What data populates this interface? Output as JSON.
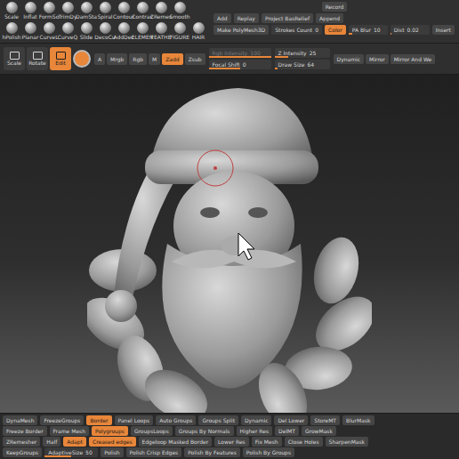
{
  "palette": {
    "rows": [
      [
        "Scale",
        "Inflat",
        "FormSo",
        "TrimDy",
        "DamSta",
        "Spiral",
        "Contour",
        "Contrac",
        "ZRemes",
        "Smooth"
      ],
      [
        "hPolish",
        "Planar",
        "CurveL",
        "CurveQ",
        "Slide",
        "DecoCu",
        "AddDec",
        "ELEMEN",
        "FEATHE",
        "FIGURE",
        "HAIR"
      ]
    ]
  },
  "stroke_panel": {
    "rows": [
      [
        {
          "kind": "button",
          "label": "Record",
          "active": false
        }
      ],
      [
        {
          "kind": "button",
          "label": "Add",
          "active": false
        },
        {
          "kind": "button",
          "label": "Replay",
          "active": false
        },
        {
          "kind": "button",
          "label": "Project BasRelief",
          "active": false
        },
        {
          "kind": "button",
          "label": "Append",
          "active": false
        }
      ],
      [
        {
          "kind": "button",
          "label": "Make PolyMesh3D",
          "active": false
        },
        {
          "kind": "slider",
          "label": "Strokes Count",
          "value": "0",
          "level": 0
        },
        {
          "kind": "button",
          "label": "Color",
          "active": true
        },
        {
          "kind": "slider",
          "label": "PA Blur",
          "value": "10",
          "level": 0.1
        },
        {
          "kind": "slider",
          "label": "Dist",
          "value": "0.02",
          "level": 0.02
        },
        {
          "kind": "button",
          "label": "Insert",
          "active": false
        }
      ]
    ]
  },
  "toolbar": {
    "transform": [
      {
        "label": "Scale",
        "selected": false
      },
      {
        "label": "Rotate",
        "selected": false
      },
      {
        "label": "Edit",
        "selected": true
      }
    ],
    "channels": [
      {
        "label": "A",
        "selected": false
      },
      {
        "label": "Mrgb",
        "selected": false
      },
      {
        "label": "Rgb",
        "selected": false
      },
      {
        "label": "M",
        "selected": false
      }
    ],
    "depth": [
      {
        "label": "Zadd",
        "selected": true
      },
      {
        "label": "Zsub",
        "selected": false
      }
    ],
    "sliders": [
      {
        "label": "Rgb Intensity",
        "value": "100",
        "level": 1,
        "disabled": true
      },
      {
        "label": "Focal Shift",
        "value": "0",
        "level": 0.5,
        "disabled": false
      },
      {
        "label": "Z Intensity",
        "value": "25",
        "level": 0.25,
        "disabled": false
      },
      {
        "label": "Draw Size",
        "value": "64",
        "level": 0.06,
        "disabled": false
      }
    ],
    "extras": [
      "Dynamic",
      "Mirror",
      "Mirror And We"
    ]
  },
  "bottom_panel": {
    "rows": [
      [
        {
          "kind": "button",
          "label": "DynaMesh",
          "active": false
        },
        {
          "kind": "button",
          "label": "FreezeGroups",
          "active": false
        },
        {
          "kind": "button",
          "label": "Border",
          "active": true
        },
        {
          "kind": "button",
          "label": "Panel Loops",
          "active": false
        },
        {
          "kind": "button",
          "label": "Auto Groups",
          "active": false
        },
        {
          "kind": "button",
          "label": "Groups Split",
          "active": false
        },
        {
          "kind": "button",
          "label": "Dynamic",
          "active": false
        },
        {
          "kind": "button",
          "label": "Del Lower",
          "active": false
        },
        {
          "kind": "button",
          "label": "StoreMT",
          "active": false
        },
        {
          "kind": "button",
          "label": "BlurMask",
          "active": false
        }
      ],
      [
        {
          "kind": "button",
          "label": "Freeze Border",
          "active": false
        },
        {
          "kind": "button",
          "label": "Frame Mesh",
          "active": false
        },
        {
          "kind": "button",
          "label": "Polygroups",
          "active": true
        },
        {
          "kind": "button",
          "label": "GroupsLoops",
          "active": false
        },
        {
          "kind": "button",
          "label": "Groups By Normals",
          "active": false
        },
        {
          "kind": "button",
          "label": "Higher Res",
          "active": false
        },
        {
          "kind": "button",
          "label": "DelMT",
          "active": false
        },
        {
          "kind": "button",
          "label": "GrowMask",
          "active": false
        }
      ],
      [
        {
          "kind": "button",
          "label": "ZRemesher",
          "active": false
        },
        {
          "kind": "button",
          "label": "Half",
          "active": false
        },
        {
          "kind": "button",
          "label": "Adapt",
          "active": true
        },
        {
          "kind": "button",
          "label": "Creased edges",
          "active": true
        },
        {
          "kind": "button",
          "label": "Edgeloop Masked Border",
          "active": false
        },
        {
          "kind": "button",
          "label": "Lower Res",
          "active": false
        },
        {
          "kind": "button",
          "label": "Fix Mesh",
          "active": false
        },
        {
          "kind": "button",
          "label": "Close Holes",
          "active": false
        },
        {
          "kind": "button",
          "label": "SharpenMask",
          "active": false
        }
      ],
      [
        {
          "kind": "button",
          "label": "KeepGroups",
          "active": false
        },
        {
          "kind": "slider",
          "label": "AdaptiveSize",
          "value": "50",
          "level": 0.5
        },
        {
          "kind": "button",
          "label": "Polish",
          "active": false
        },
        {
          "kind": "button",
          "label": "Polish Crisp Edges",
          "active": false
        },
        {
          "kind": "button",
          "label": "Polish By Features",
          "active": false
        },
        {
          "kind": "button",
          "label": "Polish By Groups",
          "active": false
        }
      ]
    ]
  }
}
